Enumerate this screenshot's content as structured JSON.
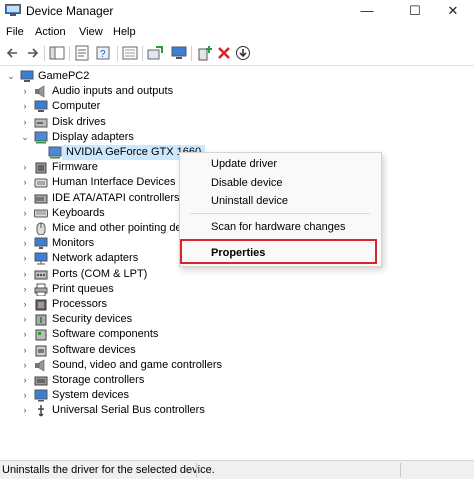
{
  "window": {
    "title": "Device Manager"
  },
  "menubar": {
    "items": [
      "File",
      "Action",
      "View",
      "Help"
    ]
  },
  "tree": {
    "root": "GamePC2",
    "categories": [
      {
        "label": "Audio inputs and outputs",
        "icon": "speaker-icon"
      },
      {
        "label": "Computer",
        "icon": "computer-icon"
      },
      {
        "label": "Disk drives",
        "icon": "disk-drive-icon"
      },
      {
        "label": "Display adapters",
        "icon": "display-adapter-icon",
        "expanded": true,
        "children": [
          {
            "label": "NVIDIA GeForce GTX 1660",
            "icon": "display-adapter-icon",
            "selected": true
          }
        ]
      },
      {
        "label": "Firmware",
        "icon": "firmware-icon"
      },
      {
        "label": "Human Interface Devices",
        "icon": "hid-icon"
      },
      {
        "label": "IDE ATA/ATAPI controllers",
        "icon": "ide-controller-icon"
      },
      {
        "label": "Keyboards",
        "icon": "keyboard-icon"
      },
      {
        "label": "Mice and other pointing devices",
        "icon": "mouse-icon"
      },
      {
        "label": "Monitors",
        "icon": "monitor-icon"
      },
      {
        "label": "Network adapters",
        "icon": "network-adapter-icon"
      },
      {
        "label": "Ports (COM & LPT)",
        "icon": "port-icon"
      },
      {
        "label": "Print queues",
        "icon": "printer-icon"
      },
      {
        "label": "Processors",
        "icon": "processor-icon"
      },
      {
        "label": "Security devices",
        "icon": "security-device-icon"
      },
      {
        "label": "Software components",
        "icon": "software-component-icon"
      },
      {
        "label": "Software devices",
        "icon": "software-device-icon"
      },
      {
        "label": "Sound, video and game controllers",
        "icon": "sound-controller-icon"
      },
      {
        "label": "Storage controllers",
        "icon": "storage-controller-icon"
      },
      {
        "label": "System devices",
        "icon": "system-device-icon"
      },
      {
        "label": "Universal Serial Bus controllers",
        "icon": "usb-controller-icon"
      }
    ]
  },
  "context_menu": {
    "update_driver": "Update driver",
    "disable_device": "Disable device",
    "uninstall_device": "Uninstall device",
    "scan_changes": "Scan for hardware changes",
    "properties": "Properties"
  },
  "status": {
    "text": "Uninstalls the driver for the selected device."
  },
  "colors": {
    "highlight_border": "#d9232e",
    "selection": "#cce8ff",
    "accent": "#0a64c8"
  }
}
